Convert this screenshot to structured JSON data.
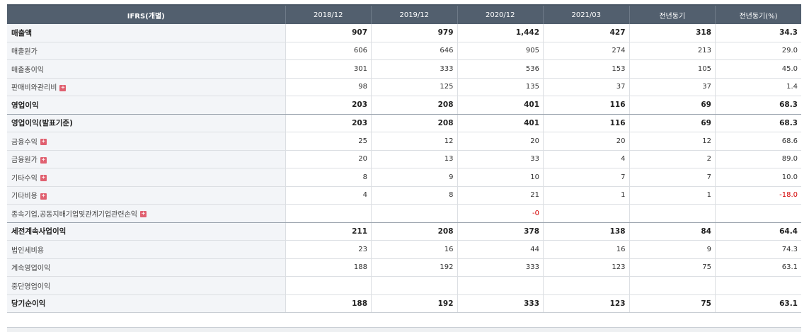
{
  "table": {
    "headers": [
      "IFRS(개별)",
      "2018/12",
      "2019/12",
      "2020/12",
      "2021/03",
      "전년동기",
      "전년동기(%)"
    ],
    "rows": [
      {
        "label": "매출액",
        "bold": true,
        "plus": false,
        "values": [
          "907",
          "979",
          "1,442",
          "427",
          "318",
          "34.3"
        ]
      },
      {
        "label": "매출원가",
        "bold": false,
        "plus": false,
        "values": [
          "606",
          "646",
          "905",
          "274",
          "213",
          "29.0"
        ]
      },
      {
        "label": "매출총이익",
        "bold": false,
        "plus": false,
        "values": [
          "301",
          "333",
          "536",
          "153",
          "105",
          "45.0"
        ]
      },
      {
        "label": "판매비와관리비",
        "bold": false,
        "plus": true,
        "values": [
          "98",
          "125",
          "135",
          "37",
          "37",
          "1.4"
        ]
      },
      {
        "label": "영업이익",
        "bold": true,
        "plus": false,
        "values": [
          "203",
          "208",
          "401",
          "116",
          "69",
          "68.3"
        ]
      },
      {
        "label": "영업이익(발표기준)",
        "bold": true,
        "plus": false,
        "values": [
          "203",
          "208",
          "401",
          "116",
          "69",
          "68.3"
        ]
      },
      {
        "label": "금융수익",
        "bold": false,
        "plus": true,
        "values": [
          "25",
          "12",
          "20",
          "20",
          "12",
          "68.6"
        ]
      },
      {
        "label": "금융원가",
        "bold": false,
        "plus": true,
        "values": [
          "20",
          "13",
          "33",
          "4",
          "2",
          "89.0"
        ]
      },
      {
        "label": "기타수익",
        "bold": false,
        "plus": true,
        "values": [
          "8",
          "9",
          "10",
          "7",
          "7",
          "10.0"
        ]
      },
      {
        "label": "기타비용",
        "bold": false,
        "plus": true,
        "values": [
          "4",
          "8",
          "21",
          "1",
          "1",
          "-18.0"
        ]
      },
      {
        "label": "종속기업,공동지배기업및관계기업관련손익",
        "bold": false,
        "plus": true,
        "values": [
          "",
          "",
          "-0",
          "",
          "",
          ""
        ]
      },
      {
        "label": "세전계속사업이익",
        "bold": true,
        "plus": false,
        "values": [
          "211",
          "208",
          "378",
          "138",
          "84",
          "64.4"
        ]
      },
      {
        "label": "법인세비용",
        "bold": false,
        "plus": false,
        "values": [
          "23",
          "16",
          "44",
          "16",
          "9",
          "74.3"
        ]
      },
      {
        "label": "계속영업이익",
        "bold": false,
        "plus": false,
        "values": [
          "188",
          "192",
          "333",
          "123",
          "75",
          "63.1"
        ]
      },
      {
        "label": "중단영업이익",
        "bold": false,
        "plus": false,
        "values": [
          "",
          "",
          "",
          "",
          "",
          ""
        ]
      },
      {
        "label": "당기순이익",
        "bold": true,
        "plus": false,
        "values": [
          "188",
          "192",
          "333",
          "123",
          "75",
          "63.1"
        ]
      }
    ],
    "expand_icon": "plus-square-icon",
    "colors": {
      "header_bg": "#525f6e",
      "label_bg": "#f3f5f8",
      "negative": "#d40000",
      "expand_icon": "#e06070"
    }
  }
}
